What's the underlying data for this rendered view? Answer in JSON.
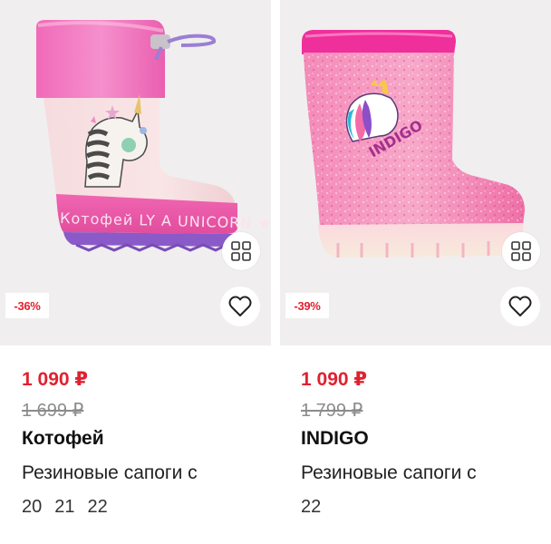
{
  "colors": {
    "price_red": "#e0212f",
    "old_price_gray": "#8c8c8c",
    "image_bg": "#f0eeef"
  },
  "products": [
    {
      "discount": "-36%",
      "price": "1 090 ₽",
      "old_price": "1 699 ₽",
      "brand": "Котофей",
      "title": "Резиновые сапоги с",
      "sizes": [
        "20",
        "21",
        "22"
      ],
      "image": {
        "subject": "pink unicorn rain boot",
        "print_text": "LY A UNICORN ★ SECRE",
        "print_brand": "Котофей"
      },
      "icons": [
        "ar-view-icon",
        "heart-icon"
      ]
    },
    {
      "discount": "-39%",
      "price": "1 090 ₽",
      "old_price": "1 799 ₽",
      "brand": "INDIGO",
      "title": "Резиновые сапоги с",
      "sizes": [
        "22"
      ],
      "image": {
        "subject": "pink glitter unicorn rain boot",
        "print_text": "INDIGO"
      },
      "icons": [
        "ar-view-icon",
        "heart-icon"
      ]
    }
  ]
}
